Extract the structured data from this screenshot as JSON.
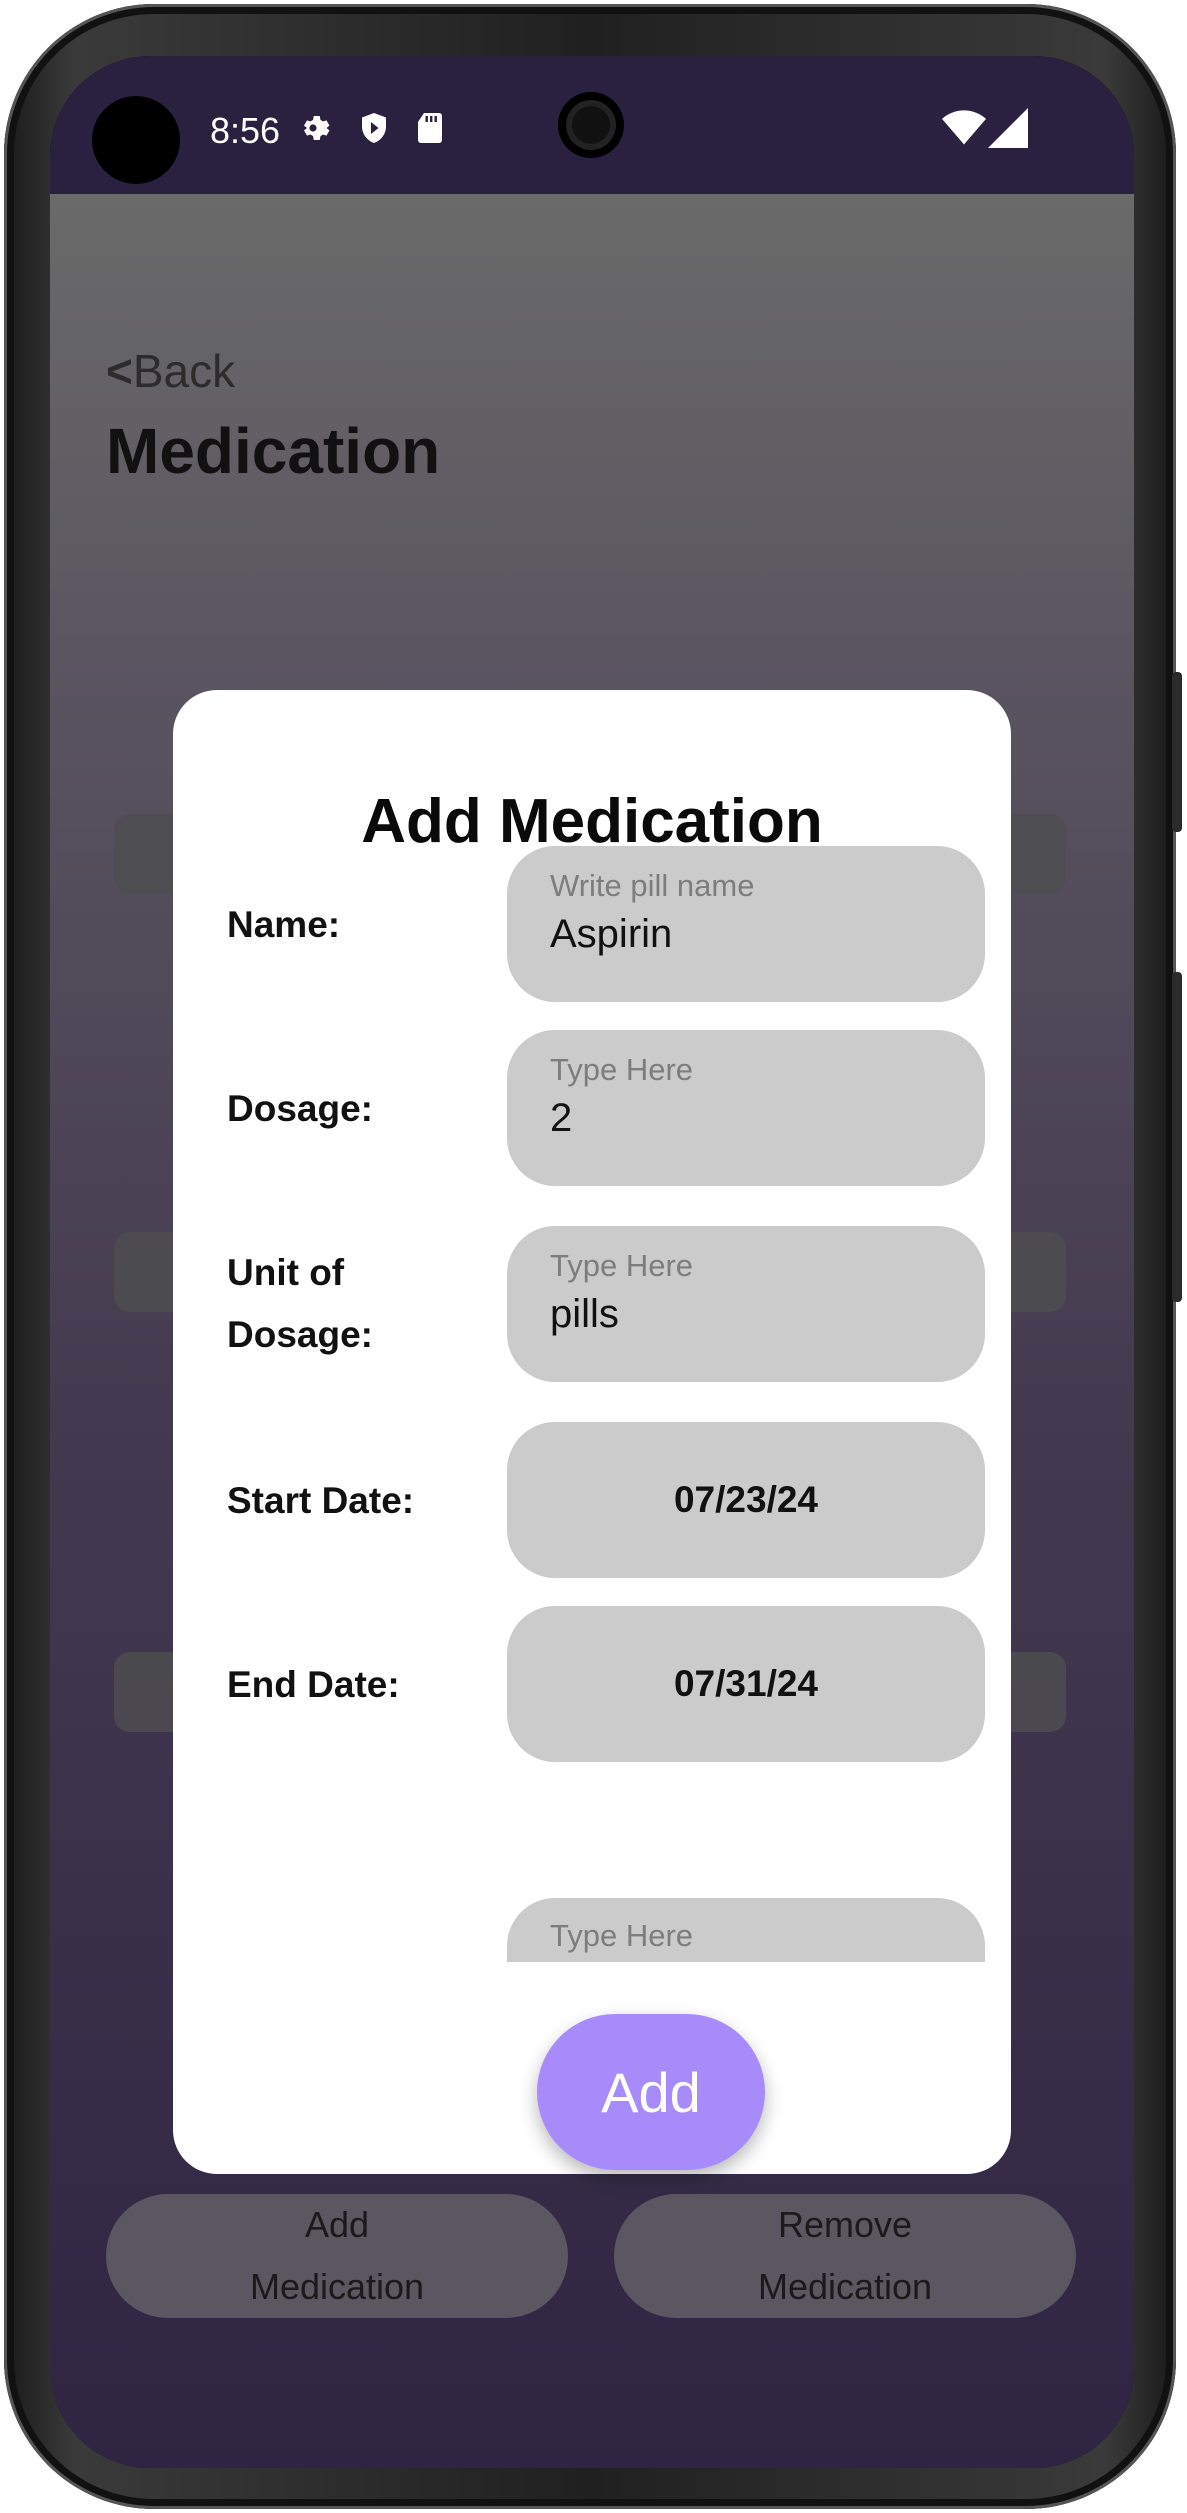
{
  "status_bar": {
    "time": "8:56",
    "icons": [
      "gear-icon",
      "shield-icon",
      "sd-card-icon",
      "wifi-icon",
      "signal-icon"
    ]
  },
  "page": {
    "back_label": "Back",
    "title": "Medication"
  },
  "bottom_bar": {
    "add_label_line1": "Add",
    "add_label_line2": "Medication",
    "remove_label_line1": "Remove",
    "remove_label_line2": "Medication"
  },
  "dialog": {
    "title": "Add Medication",
    "fields": [
      {
        "label": "Name:",
        "placeholder": "Write pill name",
        "value": "Aspirin"
      },
      {
        "label": "Dosage:",
        "placeholder": "Type Here",
        "value": "2"
      },
      {
        "label_line1": "Unit of",
        "label_line2": "Dosage:",
        "placeholder": "Type Here",
        "value": "pills"
      },
      {
        "label": "Start Date:",
        "value": "07/23/24"
      },
      {
        "label": "End Date:",
        "value": "07/31/24"
      },
      {
        "placeholder": "Type Here"
      }
    ],
    "add_button": "Add"
  },
  "colors": {
    "status_bar": "#2a2040",
    "dialog_bg": "#ffffff",
    "field_bg": "#cbcbcb",
    "add_button": "#a88bfa"
  }
}
